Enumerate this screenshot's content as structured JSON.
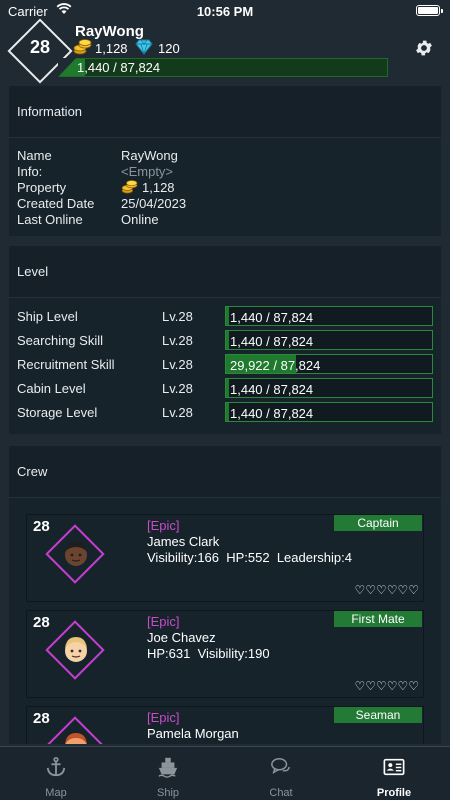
{
  "status": {
    "carrier": "Carrier",
    "time": "10:56 PM"
  },
  "profile": {
    "level": "28",
    "username": "RayWong",
    "gold": "1,128",
    "gems": "120",
    "xp_text": "1,440 / 87,824",
    "xp_fraction": 0.016
  },
  "info": {
    "title": "Information",
    "rows": [
      {
        "label": "Name",
        "value": "RayWong"
      },
      {
        "label": "Info:",
        "value": "<Empty>"
      },
      {
        "label": "Property",
        "value": "1,128"
      },
      {
        "label": "Created Date",
        "value": "25/04/2023"
      },
      {
        "label": "Last Online",
        "value": "Online"
      }
    ]
  },
  "levels": {
    "title": "Level",
    "rows": [
      {
        "name": "Ship Level",
        "lv": "Lv.28",
        "progress": "1,440 / 87,824",
        "fraction": 0.016
      },
      {
        "name": "Searching Skill",
        "lv": "Lv.28",
        "progress": "1,440 / 87,824",
        "fraction": 0.016
      },
      {
        "name": "Recruitment Skill",
        "lv": "Lv.28",
        "progress": "29,922 / 87,824",
        "fraction": 0.34
      },
      {
        "name": "Cabin Level",
        "lv": "Lv.28",
        "progress": "1,440 / 87,824",
        "fraction": 0.016
      },
      {
        "name": "Storage Level",
        "lv": "Lv.28",
        "progress": "1,440 / 87,824",
        "fraction": 0.016
      }
    ]
  },
  "crew": {
    "title": "Crew",
    "members": [
      {
        "level": "28",
        "rarity": "[Epic]",
        "name": "James Clark",
        "stats": "Visibility:166  HP:552  Leadership:4",
        "role": "Captain",
        "hearts": "♡♡♡♡♡♡"
      },
      {
        "level": "28",
        "rarity": "[Epic]",
        "name": "Joe Chavez",
        "stats": "HP:631  Visibility:190",
        "role": "First Mate",
        "hearts": "♡♡♡♡♡♡"
      },
      {
        "level": "28",
        "rarity": "[Epic]",
        "name": "Pamela Morgan",
        "stats": "",
        "role": "Seaman",
        "hearts": ""
      }
    ]
  },
  "tabs": [
    {
      "label": "Map",
      "icon": "anchor-icon"
    },
    {
      "label": "Ship",
      "icon": "ship-icon"
    },
    {
      "label": "Chat",
      "icon": "chat-icon"
    },
    {
      "label": "Profile",
      "icon": "profile-card-icon",
      "active": true
    }
  ],
  "colors": {
    "bar_green": "#1f7a2e",
    "epic": "#c84cc8",
    "role_badge": "#237a35",
    "gem": "#3fc6e8",
    "coin": "#f2c230"
  }
}
